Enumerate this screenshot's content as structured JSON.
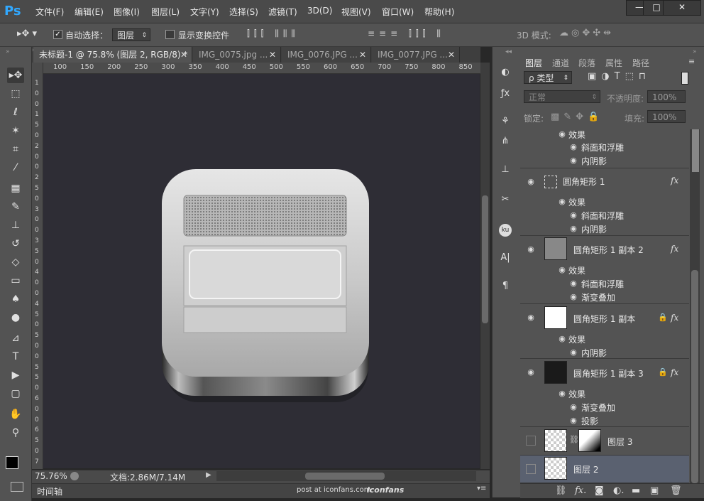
{
  "app": {
    "logo": "Ps",
    "brand_color": "#31a8ff"
  },
  "menubar": {
    "items": [
      "文件(F)",
      "编辑(E)",
      "图像(I)",
      "图层(L)",
      "文字(Y)",
      "选择(S)",
      "滤镜(T)",
      "3D(D)",
      "视图(V)",
      "窗口(W)",
      "帮助(H)"
    ],
    "window_buttons": [
      "—",
      "□",
      "✕"
    ]
  },
  "options": {
    "auto_select_label": "自动选择：",
    "auto_select_checked": true,
    "auto_select_target": "图层",
    "show_transform_label": "显示变换控件",
    "show_transform_checked": false,
    "mode_3d_label": "3D 模式:"
  },
  "tabs": [
    {
      "label": "未标题-1 @ 75.8% (图层 2, RGB/8) *",
      "active": true
    },
    {
      "label": "IMG_0075.jpg ...",
      "active": false
    },
    {
      "label": "IMG_0076.JPG ...",
      "active": false
    },
    {
      "label": "IMG_0077.JPG ...",
      "active": false
    }
  ],
  "ruler": {
    "top": [
      "100",
      "150",
      "200",
      "250",
      "300",
      "350",
      "400",
      "450",
      "500",
      "550",
      "600",
      "650",
      "700",
      "750",
      "800",
      "850"
    ],
    "left": [
      "1",
      "0",
      "0",
      "1",
      "5",
      "0",
      "2",
      "0",
      "0",
      "2",
      "5",
      "0",
      "3",
      "0",
      "0",
      "3",
      "5",
      "0",
      "4",
      "0",
      "0",
      "4",
      "5",
      "0",
      "5",
      "0",
      "0",
      "5",
      "5",
      "0",
      "6",
      "0",
      "0",
      "6",
      "5",
      "0",
      "7"
    ]
  },
  "status": {
    "zoom": "75.76%",
    "doc": "文档:2.86M/7.14M",
    "timeline": "时间轴",
    "watermark": "post at iconfans.com",
    "watermark_logo": "iconfans"
  },
  "panel": {
    "tabs": [
      {
        "label": "图层",
        "active": true
      },
      {
        "label": "通道",
        "active": false
      },
      {
        "label": "段落",
        "active": false
      },
      {
        "label": "属性",
        "active": false
      },
      {
        "label": "路径",
        "active": false
      }
    ],
    "filter_label": "ρ 类型",
    "blend_mode": "正常",
    "opacity_label": "不透明度:",
    "opacity_value": "100%",
    "lock_label": "锁定:",
    "fill_label": "填充:",
    "fill_value": "100%"
  },
  "layers": {
    "r0": {
      "effects": "效果",
      "e1": "斜面和浮雕",
      "e2": "内阴影"
    },
    "r1": {
      "name": "圆角矩形 1",
      "effects": "效果",
      "e1": "斜面和浮雕",
      "e2": "内阴影"
    },
    "r2": {
      "name": "圆角矩形 1 副本 2",
      "effects": "效果",
      "e1": "斜面和浮雕",
      "e2": "渐变叠加"
    },
    "r3": {
      "name": "圆角矩形 1 副本",
      "effects": "效果",
      "e1": "内阴影"
    },
    "r4": {
      "name": "圆角矩形 1 副本 3",
      "effects": "效果",
      "e1": "渐变叠加",
      "e2": "投影"
    },
    "r5": {
      "name": "图层 3"
    },
    "r6": {
      "name": "图层 2",
      "selected": true
    },
    "fx": "fx"
  },
  "icons": {
    "move": "move-tool-icon",
    "eye": "eye-icon",
    "lock": "lock-icon",
    "link": "link-icon"
  },
  "colors": {
    "canvas_bg": "#2e2d35",
    "selected_layer": "#5a6170",
    "panel_bg": "#535353"
  }
}
